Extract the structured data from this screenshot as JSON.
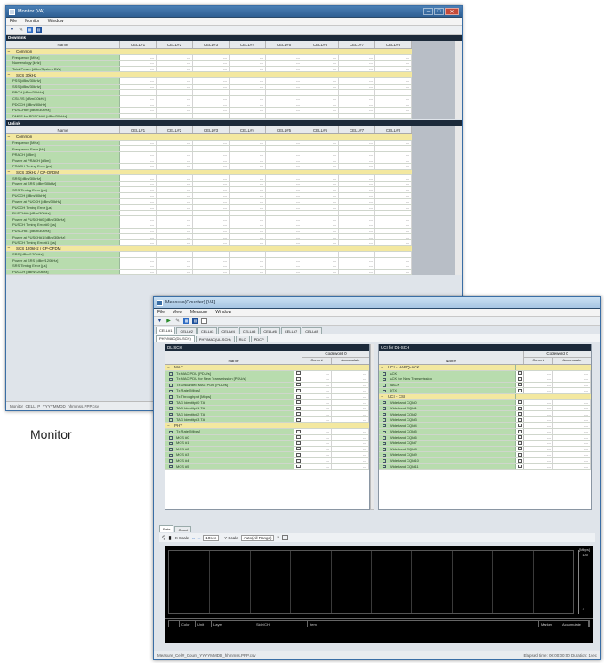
{
  "monitor": {
    "title": "Monitor [VA]",
    "menu": [
      "File",
      "Monitor",
      "Window"
    ],
    "downlink_label": "Downlink",
    "uplink_label": "Uplink",
    "name_header": "Name",
    "cells": [
      "CELL#1",
      "CELL#2",
      "CELL#3",
      "CELL#4",
      "CELL#5",
      "CELL#6",
      "CELL#7",
      "CELL#8"
    ],
    "cell_value": "---",
    "downlink_rows": [
      {
        "type": "group",
        "label": "Common"
      },
      {
        "type": "item",
        "label": "Frequency [MHz]"
      },
      {
        "type": "item",
        "label": "Numerology [kHz]"
      },
      {
        "type": "item",
        "label": "Total Power [dBm/System BW]"
      },
      {
        "type": "group",
        "label": "SCS 30kHz"
      },
      {
        "type": "item",
        "label": "PSS [dBm/30kHz]"
      },
      {
        "type": "item",
        "label": "SSS [dBm/30kHz]"
      },
      {
        "type": "item",
        "label": "PBCH [dBm/30kHz]"
      },
      {
        "type": "item",
        "label": "CSI-RS [dBm/30kHz]"
      },
      {
        "type": "item",
        "label": "PDCCH [dBm/30kHz]"
      },
      {
        "type": "item",
        "label": "PDSCH#0 [dBm/30kHz]"
      },
      {
        "type": "item",
        "label": "DMRS for PDSCH#0 [dBm/30kHz]"
      }
    ],
    "uplink_rows": [
      {
        "type": "group",
        "label": "Common"
      },
      {
        "type": "item",
        "label": "Frequency [MHz]"
      },
      {
        "type": "item",
        "label": "Frequency Error [Hz]"
      },
      {
        "type": "item",
        "label": "PRACH [dBm]"
      },
      {
        "type": "item",
        "label": "Power at PRACH [dBm]"
      },
      {
        "type": "item",
        "label": "PRACH Timing Error [µs]"
      },
      {
        "type": "group",
        "label": "SCS 30kHz / CP-OFDM"
      },
      {
        "type": "item",
        "label": "SRS [dBm/30kHz]"
      },
      {
        "type": "item",
        "label": "Power at SRS [dBm/30kHz]"
      },
      {
        "type": "item",
        "label": "SRS Timing Error [µs]"
      },
      {
        "type": "item",
        "label": "PUCCH [dBm/30kHz]"
      },
      {
        "type": "item",
        "label": "Power at PUCCH [dBm/30kHz]"
      },
      {
        "type": "item",
        "label": "PUCCH Timing Error [µs]"
      },
      {
        "type": "item",
        "label": "PUSCH#0 [dBm/30kHz]"
      },
      {
        "type": "item",
        "label": "Power at PUSCH#0 [dBm/30kHz]"
      },
      {
        "type": "item",
        "label": "PUSCH Timing Error#0 [µs]"
      },
      {
        "type": "item",
        "label": "PUSCH#1 [dBm/30kHz]"
      },
      {
        "type": "item",
        "label": "Power at PUSCH#1 [dBm/30kHz]"
      },
      {
        "type": "item",
        "label": "PUSCH Timing Error#1 [µs]"
      },
      {
        "type": "group",
        "label": "SCS 120kHz / CP-OFDM"
      },
      {
        "type": "item",
        "label": "SRS [dBm/120kHz]"
      },
      {
        "type": "item",
        "label": "Power at SRS [dBm/120kHz]"
      },
      {
        "type": "item",
        "label": "SRS Timing Error [µs]"
      },
      {
        "type": "item",
        "label": "PUCCH [dBm/120kHz]"
      }
    ],
    "status": "Monitor_CELL_P_YYYYMMDD_hhmmss.PPP.csv"
  },
  "caption": "Monitor",
  "measure": {
    "title": "Measure(Counter) [VA]",
    "menu": [
      "File",
      "View",
      "Measure",
      "Window"
    ],
    "cell_tabs": [
      "CELL#1",
      "CELL#2",
      "CELL#3",
      "CELL#4",
      "CELL#5",
      "CELL#6",
      "CELL#7",
      "CELL#8"
    ],
    "sub_tabs": [
      "PHY/MAC(DL-SCH)",
      "PHY/MAC(UL-SCH)",
      "RLC",
      "PDCP"
    ],
    "left_panel": {
      "title": "DL-SCH",
      "codeword": "Codeword 0",
      "name": "Name",
      "current": "Current",
      "accumulate": "Accumulate",
      "rows": [
        {
          "type": "group",
          "label": "MAC"
        },
        {
          "type": "item",
          "label": "Tx MAC PDU [PDU/s]"
        },
        {
          "type": "item",
          "label": "Tx MAC PDU for New Transmission [PDU/s]"
        },
        {
          "type": "item",
          "label": "Tx Discarded MAC PDU [PDU/s]"
        },
        {
          "type": "item",
          "label": "Tx Rate [Mbps]"
        },
        {
          "type": "item",
          "label": "Tx Throughput [Mbps]"
        },
        {
          "type": "item",
          "label": "TAG Identity#0 TA"
        },
        {
          "type": "item",
          "label": "TAG Identity#1 TA"
        },
        {
          "type": "item",
          "label": "TAG Identity#2 TA"
        },
        {
          "type": "item",
          "label": "TAG Identity#3 TA"
        },
        {
          "type": "group",
          "label": "PHY"
        },
        {
          "type": "item",
          "label": "Tx Rate [Mbps]"
        },
        {
          "type": "item",
          "label": "MCS #0"
        },
        {
          "type": "item",
          "label": "MCS #1"
        },
        {
          "type": "item",
          "label": "MCS #2"
        },
        {
          "type": "item",
          "label": "MCS #3"
        },
        {
          "type": "item",
          "label": "MCS #4"
        },
        {
          "type": "item",
          "label": "MCS #5"
        }
      ]
    },
    "right_panel": {
      "title": "UCI for DL-SCH",
      "codeword": "Codeword 0",
      "name": "Name",
      "current": "Current",
      "accumulate": "Accumulate",
      "rows": [
        {
          "type": "group",
          "label": "UCI - HARQ-ACK"
        },
        {
          "type": "item",
          "label": "ACK"
        },
        {
          "type": "item",
          "label": "ACK for New Transmission"
        },
        {
          "type": "item",
          "label": "NACK"
        },
        {
          "type": "item",
          "label": "DTX"
        },
        {
          "type": "group",
          "label": "UCI - CSI"
        },
        {
          "type": "item",
          "label": "Wideband CQI#0"
        },
        {
          "type": "item",
          "label": "Wideband CQI#1"
        },
        {
          "type": "item",
          "label": "Wideband CQI#2"
        },
        {
          "type": "item",
          "label": "Wideband CQI#3"
        },
        {
          "type": "item",
          "label": "Wideband CQI#4"
        },
        {
          "type": "item",
          "label": "Wideband CQI#5"
        },
        {
          "type": "item",
          "label": "Wideband CQI#6"
        },
        {
          "type": "item",
          "label": "Wideband CQI#7"
        },
        {
          "type": "item",
          "label": "Wideband CQI#8"
        },
        {
          "type": "item",
          "label": "Wideband CQI#9"
        },
        {
          "type": "item",
          "label": "Wideband CQI#10"
        },
        {
          "type": "item",
          "label": "Wideband CQI#11"
        }
      ]
    },
    "value": "---",
    "graph_tabs": [
      "Rate",
      "Count"
    ],
    "xscale_label": "X Scale",
    "xscale_value": "10sec",
    "yscale_label": "Y Scale",
    "yscale_value": "Auto(All Range)",
    "graph_unit": "[Mbps]",
    "graph_ymax": "100",
    "graph_ymin": "0",
    "legend_cols": [
      "Color",
      "Unit",
      "Layer",
      "Side/CH",
      "Item",
      "Marker",
      "Accumulate"
    ],
    "status_left": "Measure_Cell#_Count_YYYYMMDD_hhmmss.PPP.csv",
    "status_right": "Elapsed time: 00:00:00:00   Duration: 1sec"
  },
  "colors": {
    "accent": "#2e6cc4",
    "cell_green": "#b8dcae",
    "group_yellow": "#f3e8a0",
    "title_dark": "#1c2a3a"
  }
}
